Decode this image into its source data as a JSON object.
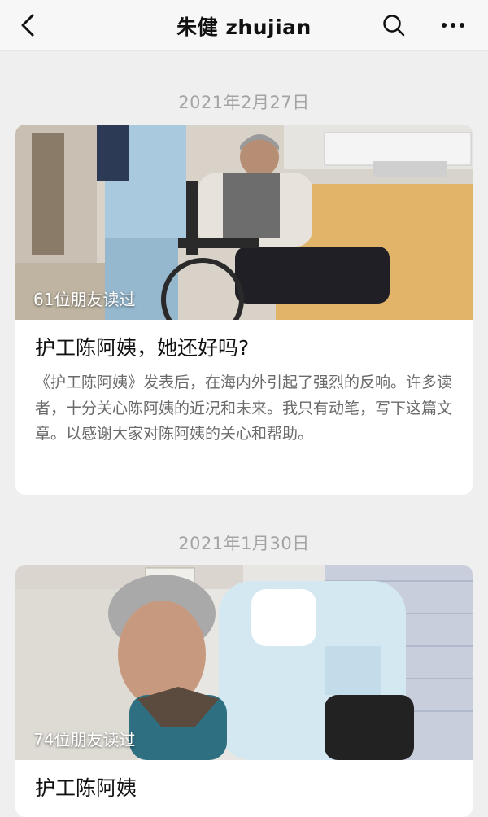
{
  "header": {
    "title": "朱健 zhujian",
    "back_icon": "chevron-left-icon",
    "search_icon": "search-icon",
    "more_icon": "more-dots-icon"
  },
  "articles": [
    {
      "date": "2021年2月27日",
      "readers": "61位朋友读过",
      "title": "护工陈阿姨，她还好吗?",
      "summary": "《护工陈阿姨》发表后，在海内外引起了强烈的反响。许多读者，十分关心陈阿姨的近况和未来。我只有动笔，写下这篇文章。以感谢大家对陈阿姨的关心和帮助。",
      "image": "photo-caregiver-pushing-elderly-woman-in-wheelchair"
    },
    {
      "date": "2021年1月30日",
      "readers": "74位朋友读过",
      "title": "护工陈阿姨",
      "image": "photo-elderly-woman-with-masked-caregiver"
    }
  ],
  "colors": {
    "background": "#efefef",
    "card": "#ffffff",
    "date_text": "#a4a4a4",
    "summary_text": "#6a6a6a"
  }
}
